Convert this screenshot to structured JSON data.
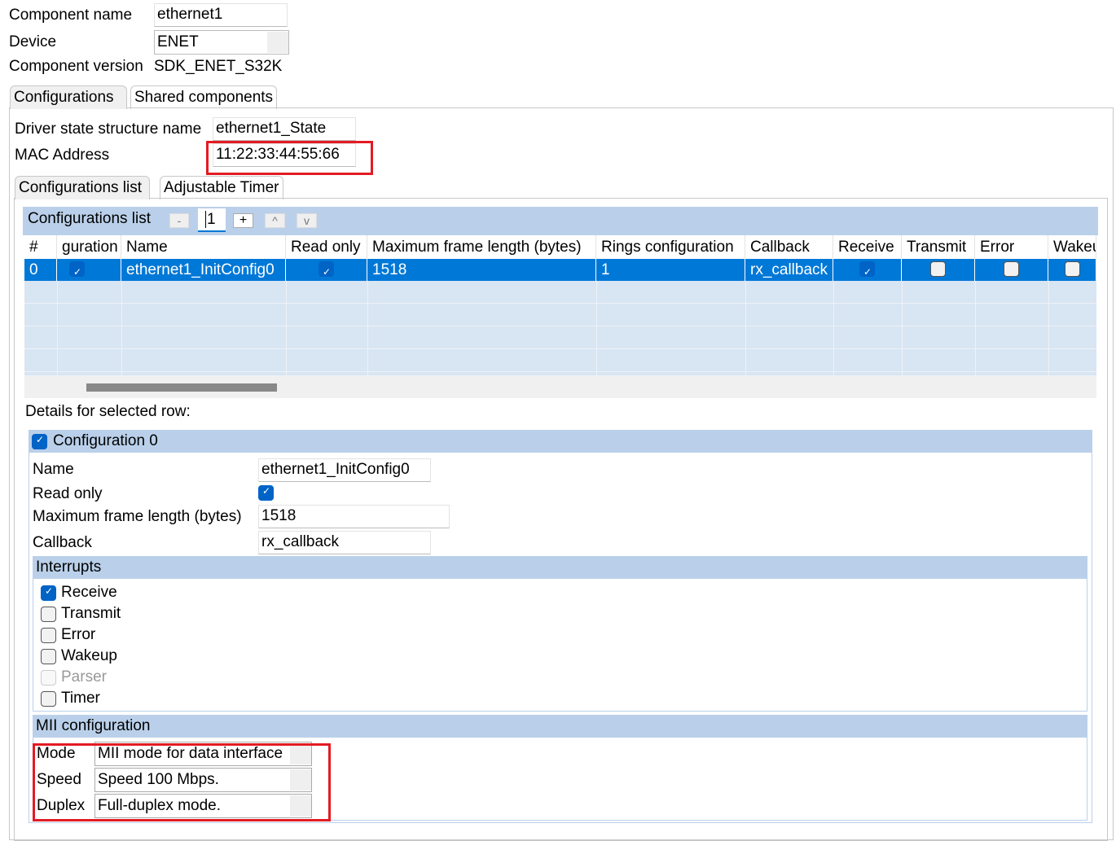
{
  "component": {
    "name_label": "Component name",
    "name_value": "ethernet1",
    "device_label": "Device",
    "device_value": "ENET",
    "version_label": "Component version",
    "version_value": "SDK_ENET_S32K"
  },
  "tabs": [
    "Configurations",
    "Shared components"
  ],
  "driver": {
    "state_label": "Driver state structure name",
    "state_value": "ethernet1_State",
    "mac_label": "MAC Address",
    "mac_value": "11:22:33:44:55:66"
  },
  "subtabs": [
    "Configurations list",
    "Adjustable Timer"
  ],
  "list": {
    "title": "Configurations list",
    "count": "1",
    "buttons": [
      "-",
      "+",
      "^",
      "v"
    ],
    "columns": [
      "#",
      "guration",
      "Name",
      "Read only",
      "Maximum frame length (bytes)",
      "Rings configuration",
      "Callback",
      "Receive",
      "Transmit",
      "Error",
      "Wakeu"
    ],
    "rows": [
      {
        "index": "0",
        "enabled": true,
        "name": "ethernet1_InitConfig0",
        "read_only": true,
        "max_frame": "1518",
        "rings": "1",
        "callback": "rx_callback",
        "receive": true,
        "transmit": false,
        "error": false,
        "wakeup": false
      }
    ]
  },
  "details": {
    "title": "Details for selected row:",
    "config_title": "Configuration 0",
    "config_checked": true,
    "name_label": "Name",
    "name_value": "ethernet1_InitConfig0",
    "readonly_label": "Read only",
    "readonly_checked": true,
    "maxframe_label": "Maximum frame length (bytes)",
    "maxframe_value": "1518",
    "callback_label": "Callback",
    "callback_value": "rx_callback",
    "interrupts_title": "Interrupts",
    "interrupts": [
      {
        "label": "Receive",
        "checked": true
      },
      {
        "label": "Transmit",
        "checked": false
      },
      {
        "label": "Error",
        "checked": false
      },
      {
        "label": "Wakeup",
        "checked": false
      },
      {
        "label": "Parser",
        "checked": false,
        "disabled": true
      },
      {
        "label": "Timer",
        "checked": false
      }
    ],
    "mii_title": "MII configuration",
    "mode_label": "Mode",
    "mode_value": "MII mode for data interface",
    "speed_label": "Speed",
    "speed_value": "Speed 100 Mbps.",
    "duplex_label": "Duplex",
    "duplex_value": "Full-duplex mode."
  },
  "colors": {
    "accent": "#0078d7",
    "header_bar": "#bad0ea",
    "highlight": "#e31b23"
  }
}
